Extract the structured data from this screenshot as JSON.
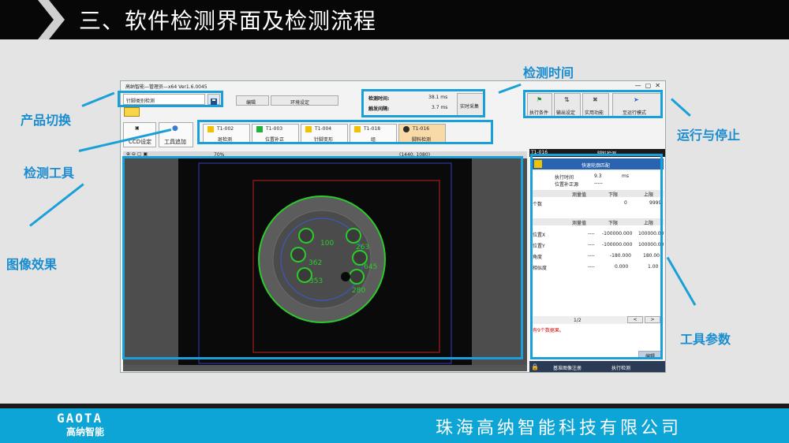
{
  "slide": {
    "title": "三、软件检测界面及检测流程",
    "company": "珠海高纳智能科技有限公司",
    "logo": "GAOTA",
    "logo_cn": "高纳智能"
  },
  "annotations": {
    "product_switch": "产品切换",
    "detect_tool": "检测工具",
    "image_effect": "图像效果",
    "detect_time": "检测时间",
    "run_stop": "运行与停止",
    "tool_params": "工具参数"
  },
  "app": {
    "window_title": "高纳智能—管理员—x64 Ver1.6.0045",
    "product_select": "针脚类别检测",
    "menu_edit": "编辑",
    "menu_env": "环境设定",
    "time_label": "检测时间:",
    "time_value": "38.1 ms",
    "interval_label": "触发间隔:",
    "interval_value": "3.7 ms",
    "realtime_button": "实时采集",
    "run_buttons": [
      "执行条件",
      "输出设定",
      "实用功能",
      "至运行模式"
    ],
    "ccd_button": "CCD设定",
    "tool_add_button": "工具追加",
    "tools": [
      {
        "id": "T1-002",
        "name": "斑检测"
      },
      {
        "id": "T1-003",
        "name": "位置补正"
      },
      {
        "id": "T1-004",
        "name": "针脚变形"
      },
      {
        "id": "T1-018",
        "name": "组"
      },
      {
        "id": "T1-016",
        "name": "脚料检测"
      }
    ],
    "zoom": "70%",
    "resolution": "(1440, 1080)",
    "panel_header_id": "T1-016",
    "panel_header_name": "脚料检测",
    "panel_tab": "快速轮廓匹配",
    "exec_time_label": "执行时间",
    "exec_time_value": "9.3",
    "exec_time_unit": "ms",
    "offset_label": "位置补正源",
    "offset_value": "-----",
    "col_measured": "测量值",
    "col_lower": "下限",
    "col_upper": "上限",
    "count_label": "个数",
    "count_measured": "",
    "count_lower": "0",
    "count_upper": "9999",
    "rows": [
      {
        "label": "位置X",
        "measured": "----",
        "lower": "-100000.000",
        "upper": "100000.00"
      },
      {
        "label": "位置Y",
        "measured": "----",
        "lower": "-100000.000",
        "upper": "100000.00"
      },
      {
        "label": "角度",
        "measured": "----",
        "lower": "-180.000",
        "upper": "180.00"
      },
      {
        "label": "相似度",
        "measured": "----",
        "lower": "0.000",
        "upper": "1.00"
      }
    ],
    "page": "1/2",
    "error_text": "有9个数据果。",
    "edit_button": "编辑",
    "base_image_button": "基准图像注册",
    "execute_button": "执行检测"
  },
  "image_labels": [
    "100",
    "263",
    "362",
    "353",
    "645",
    "280"
  ]
}
